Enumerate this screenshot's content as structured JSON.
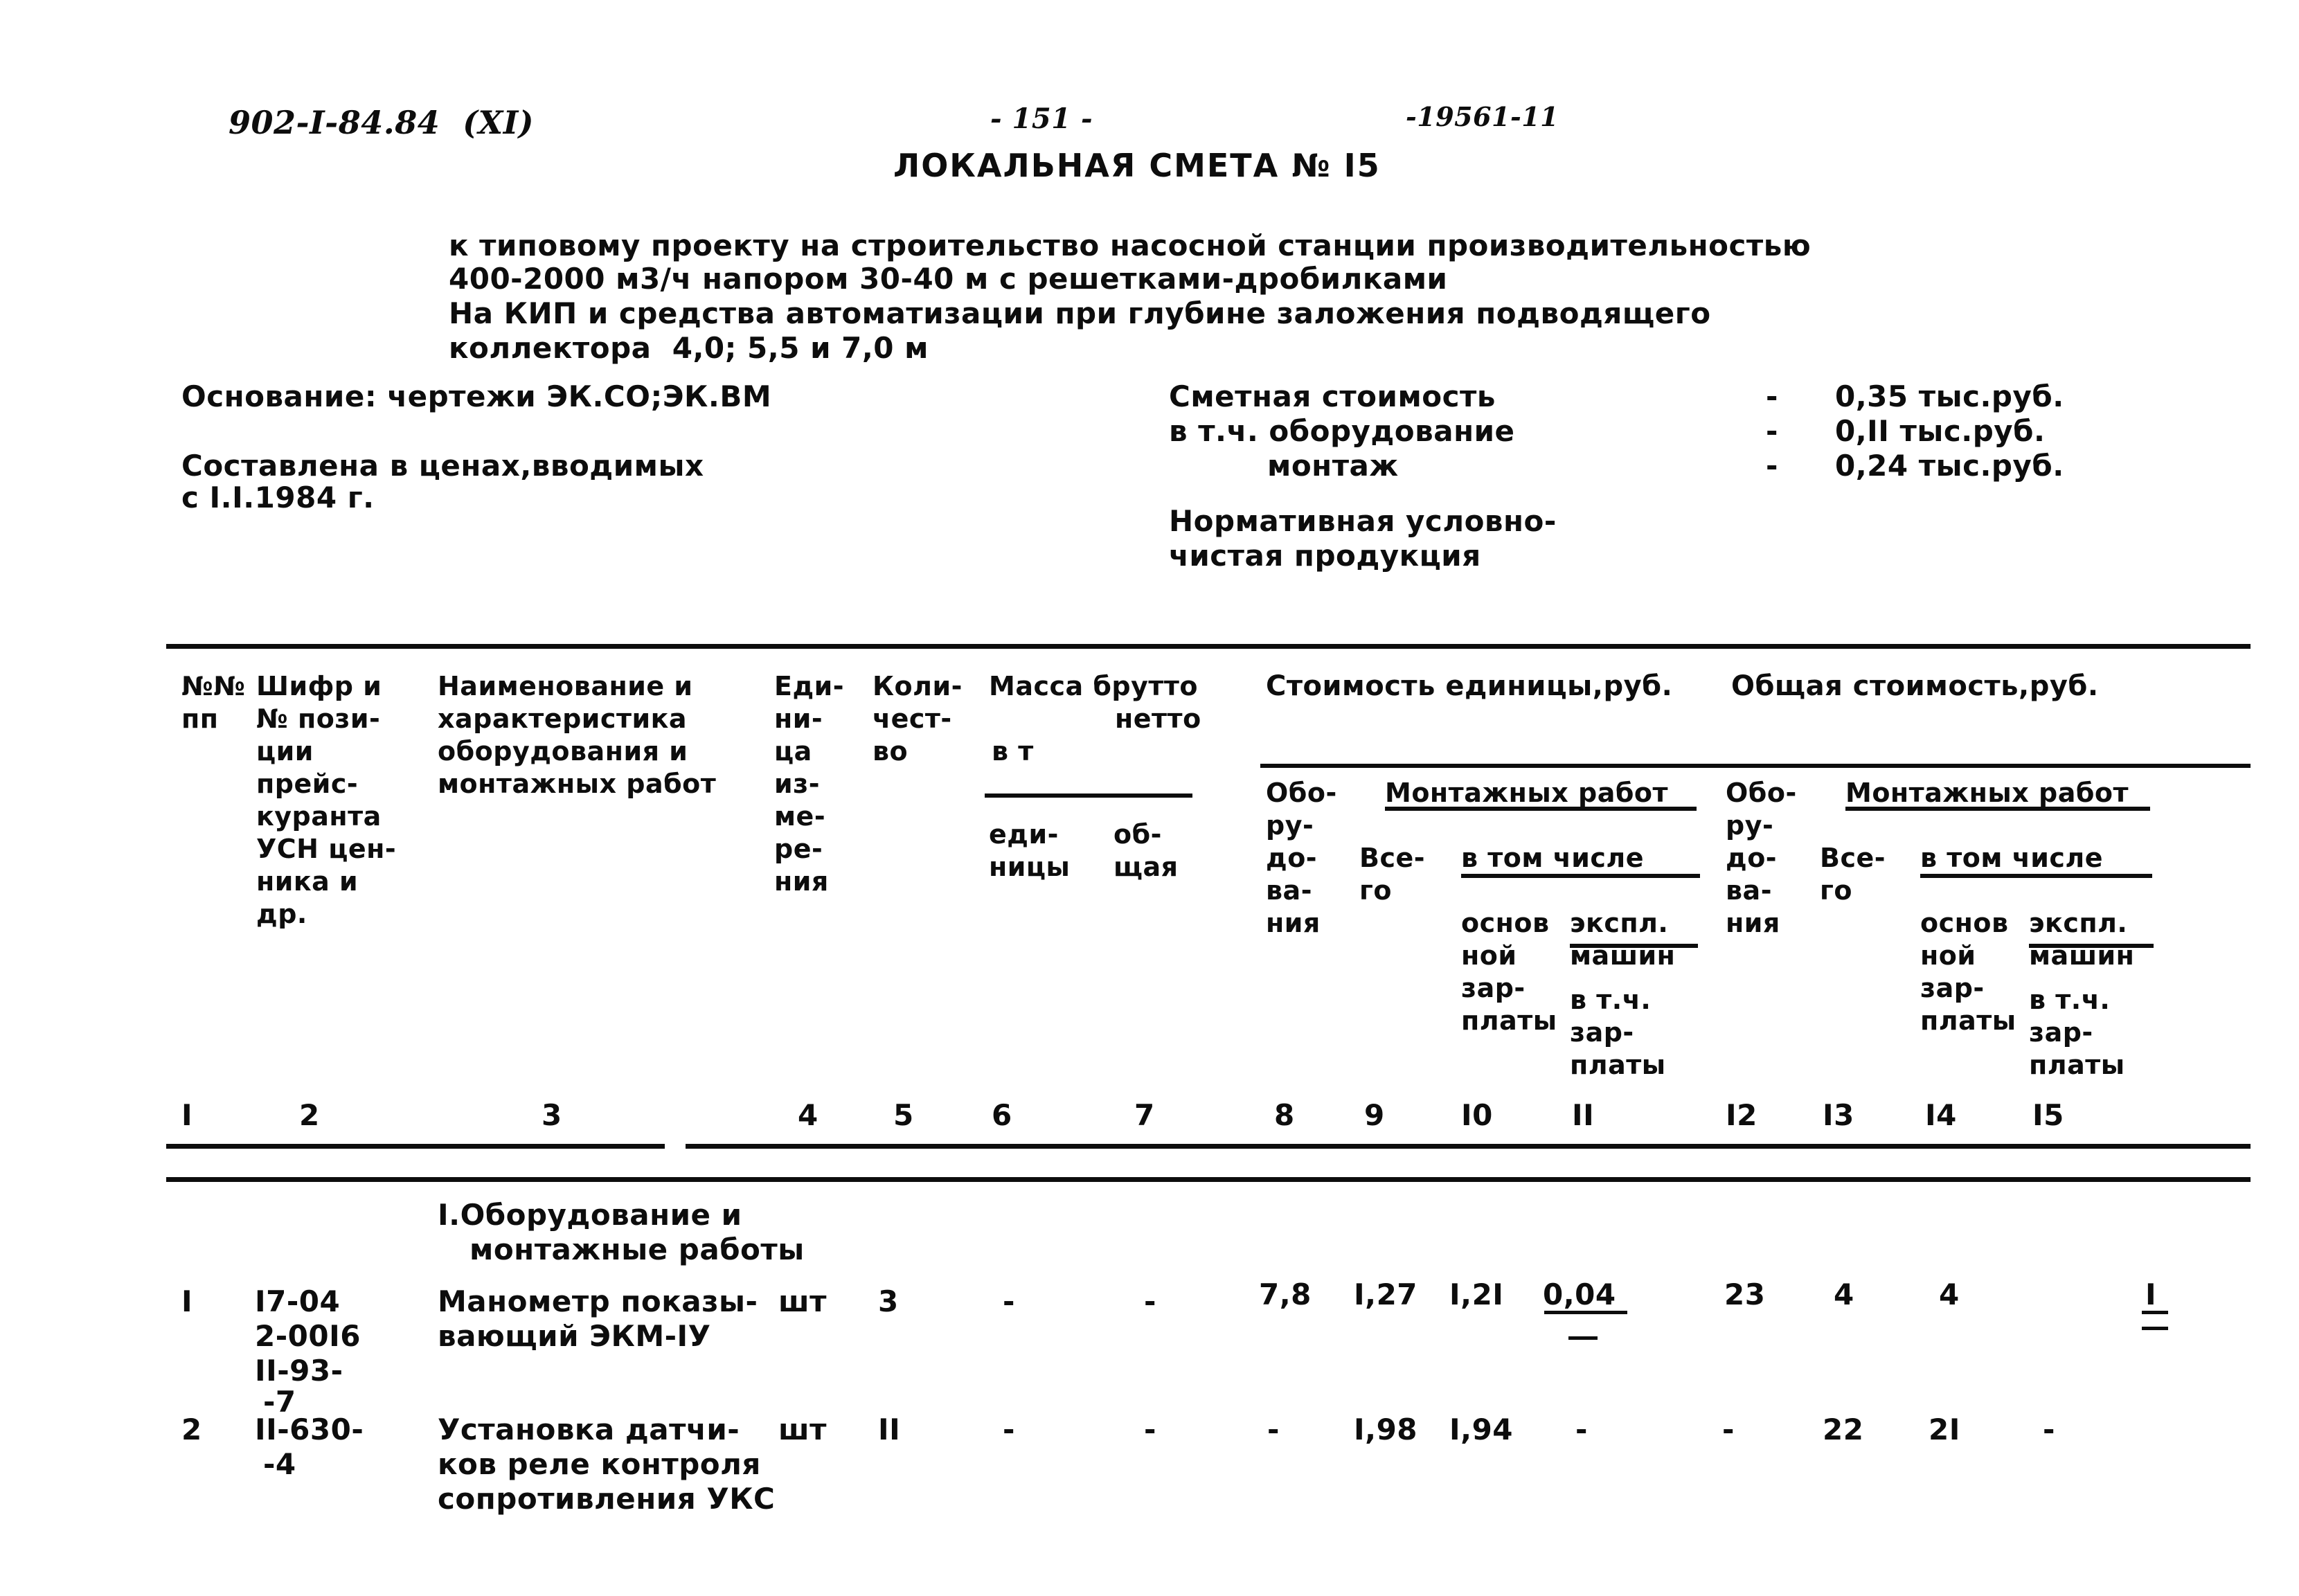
{
  "header": {
    "doc_code": "902-I-84.84  (XI)",
    "page_number": "- 151 -",
    "archive_stamp": "-19561-11",
    "title": "ЛОКАЛЬНАЯ СМЕТА № I5"
  },
  "subtitle": {
    "line1": "к типовому проекту на строительство насосной станции производительностью",
    "line2": "400-2000 м3/ч напором 30-40 м с решетками-дробилками",
    "line3": "На КИП и средства автоматизации при глубине заложения подводящего",
    "line4": "коллектора  4,0; 5,5 и 7,0 м"
  },
  "basis": {
    "basis_line": "Основание: чертежи ЭК.СО;ЭК.ВМ",
    "prices_line1": "Составлена в ценах,вводимых",
    "prices_line2": "с I.I.1984 г."
  },
  "summary": {
    "items": [
      {
        "label": "Сметная стоимость",
        "dash": "-",
        "value": "0,35 тыс.руб."
      },
      {
        "label": "в т.ч. оборудование",
        "dash": "-",
        "value": "0,II тыс.руб."
      },
      {
        "label": "монтаж",
        "dash": "-",
        "value": "0,24 тыс.руб."
      }
    ],
    "nchp_line1": "Нормативная условно-",
    "nchp_line2": "чистая продукция"
  },
  "table": {
    "headers": {
      "c1_l1": "№№",
      "c1_l2": "пп",
      "c2_l1": "Шифр и",
      "c2_l2": "№ пози-",
      "c2_l3": "ции",
      "c2_l4": "прейс-",
      "c2_l5": "куранта",
      "c2_l6": "УСН цен-",
      "c2_l7": "ника и",
      "c2_l8": "др.",
      "c3_l1": "Наименование и",
      "c3_l2": "характеристика",
      "c3_l3": "оборудования и",
      "c3_l4": "монтажных работ",
      "c4_l1": "Еди-",
      "c4_l2": "ни-",
      "c4_l3": "ца",
      "c4_l4": "из-",
      "c4_l5": "ме-",
      "c4_l6": "ре-",
      "c4_l7": "ния",
      "c5_l1": "Коли-",
      "c5_l2": "чест-",
      "c5_l3": "во",
      "massa_brutto": "Масса брутто",
      "massa_netto": "нетто",
      "massa_vt": "в т",
      "c6_l1": "еди-",
      "c6_l2": "ницы",
      "c7_l1": "об-",
      "c7_l2": "щая",
      "group_unit_cost": "Стоимость единицы,руб.",
      "group_total_cost": "Общая стоимость,руб.",
      "equip_l1": "Обо-",
      "equip_l2": "ру-",
      "equip_l3": "до-",
      "equip_l4": "ва-",
      "equip_l5": "ния",
      "montazh": "Монтажных работ",
      "vsego_l1": "Все-",
      "vsego_l2": "го",
      "vtomchisle": "в том числе",
      "osnov_l1": "основ",
      "osnov_l2": "ной",
      "osnov_l3": "зар-",
      "osnov_l4": "платы",
      "mashin_l1": "экспл.",
      "mashin_l2": "машин",
      "mashin_l3": "в т.ч.",
      "mashin_l4": "зар-",
      "mashin_l5": "платы"
    },
    "column_numbers": [
      "I",
      "2",
      "3",
      "4",
      "5",
      "6",
      "7",
      "8",
      "9",
      "I0",
      "II",
      "I2",
      "I3",
      "I4",
      "I5"
    ],
    "section_title_l1": "I.Оборудование и",
    "section_title_l2": "монтажные работы",
    "rows": [
      {
        "no": "I",
        "code_l1": "I7-04",
        "code_l2": "2-00I6",
        "code_l3": "II-93-",
        "code_l4": "-7",
        "name_l1": "Манометр показы-",
        "name_l2": "вающий ЭКМ-IУ",
        "name_l3": "",
        "unit": "шт",
        "qty": "3",
        "mass_unit": "-",
        "mass_total": "-",
        "unit_equip": "7,8",
        "unit_mont_vsego": "I,27",
        "unit_mont_zp": "I,2I",
        "unit_mont_mash": "0,04",
        "total_equip": "23",
        "total_mont_vsego": "4",
        "total_mont_zp": "4",
        "total_mont_mash": "I"
      },
      {
        "no": "2",
        "code_l1": "II-630-",
        "code_l2": "-4",
        "code_l3": "",
        "code_l4": "",
        "name_l1": "Установка датчи-",
        "name_l2": "ков реле контроля",
        "name_l3": "сопротивления УКС",
        "unit": "шт",
        "qty": "II",
        "mass_unit": "-",
        "mass_total": "-",
        "unit_equip": "-",
        "unit_mont_vsego": "I,98",
        "unit_mont_zp": "I,94",
        "unit_mont_mash": "-",
        "total_equip": "-",
        "total_mont_vsego": "22",
        "total_mont_zp": "2I",
        "total_mont_mash": "-"
      }
    ]
  }
}
